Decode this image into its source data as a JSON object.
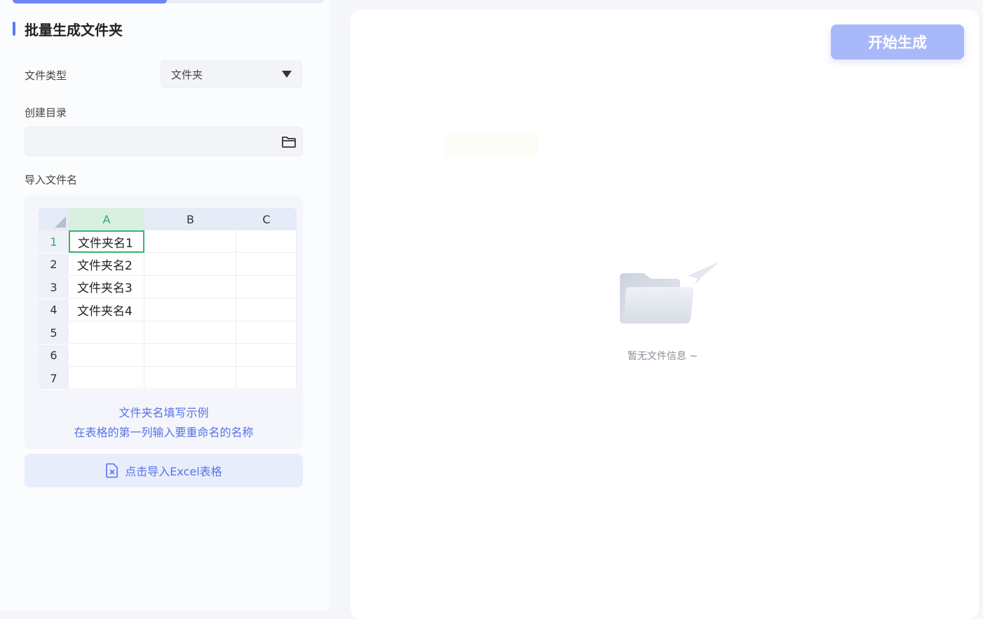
{
  "panel": {
    "title": "批量生成文件夹",
    "file_type_label": "文件类型",
    "file_type_value": "文件夹",
    "create_dir_label": "创建目录",
    "create_dir_value": "",
    "import_label": "导入文件名",
    "example": {
      "columns": [
        "A",
        "B",
        "C"
      ],
      "rows": [
        {
          "num": "1",
          "a": "文件夹名1"
        },
        {
          "num": "2",
          "a": "文件夹名2"
        },
        {
          "num": "3",
          "a": "文件夹名3"
        },
        {
          "num": "4",
          "a": "文件夹名4"
        },
        {
          "num": "5",
          "a": ""
        },
        {
          "num": "6",
          "a": ""
        },
        {
          "num": "7",
          "a": ""
        }
      ],
      "hint_title": "文件夹名填写示例",
      "hint_text": "在表格的第一列输入要重命名的名称"
    },
    "import_button_label": "点击导入Excel表格"
  },
  "main": {
    "start_button_label": "开始生成",
    "empty_text": "暂无文件信息 ~"
  },
  "colors": {
    "accent": "#5b78f2",
    "start_button": "#a9b8f8",
    "selected_cell": "#35b56a"
  },
  "icons": [
    "folder-open-icon",
    "excel-file-icon",
    "chevron-down-icon",
    "empty-folder-illustration"
  ]
}
